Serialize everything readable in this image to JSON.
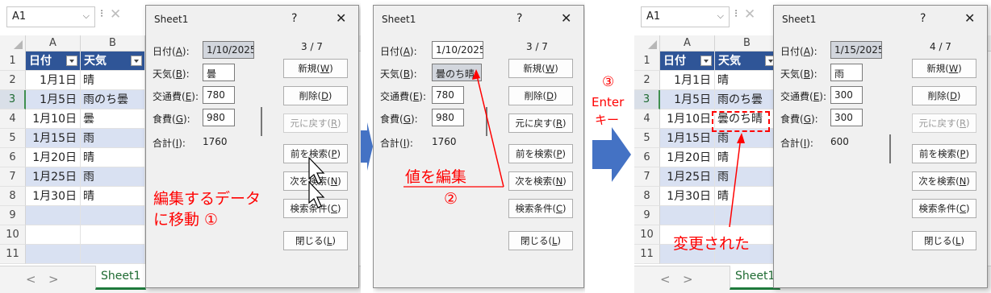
{
  "columns": [
    "A",
    "B"
  ],
  "row_numbers": [
    "1",
    "2",
    "3",
    "4",
    "5",
    "6",
    "7",
    "8",
    "9",
    "10",
    "11"
  ],
  "sheet_tab": "Sheet1",
  "tab_nav": {
    "prev": "<",
    "next": ">"
  },
  "dialog_title": "Sheet1",
  "dialog_help": "?",
  "dialog_close": "✕",
  "labels": {
    "date": {
      "pre": "日付(",
      "key": "A",
      "post": "):"
    },
    "weather": {
      "pre": "天気(",
      "key": "B",
      "post": "):"
    },
    "transport": {
      "pre": "交通費(",
      "key": "E",
      "post": "):"
    },
    "food": {
      "pre": "食費(",
      "key": "G",
      "post": "):"
    },
    "total": {
      "pre": "合計(",
      "key": "I",
      "post": "):"
    }
  },
  "buttons": {
    "new": {
      "pre": "新規(",
      "key": "W",
      "post": ")"
    },
    "delete": {
      "pre": "削除(",
      "key": "D",
      "post": ")"
    },
    "restore": {
      "pre": "元に戻す(",
      "key": "R",
      "post": ")"
    },
    "find_prev": {
      "pre": "前を検索(",
      "key": "P",
      "post": ")"
    },
    "find_next": {
      "pre": "次を検索(",
      "key": "N",
      "post": ")"
    },
    "criteria": {
      "pre": "検索条件(",
      "key": "C",
      "post": ")"
    },
    "close": {
      "pre": "閉じる(",
      "key": "L",
      "post": ")"
    }
  },
  "panel1": {
    "namebox": "A1",
    "header": [
      "日付",
      "天気"
    ],
    "rows": [
      [
        "1月1日",
        "晴"
      ],
      [
        "1月5日",
        "雨のち曇"
      ],
      [
        "1月10日",
        "曇"
      ],
      [
        "1月15日",
        "雨"
      ],
      [
        "1月20日",
        "晴"
      ],
      [
        "1月25日",
        "雨"
      ],
      [
        "1月30日",
        "晴"
      ]
    ],
    "selected_row": "3",
    "form": {
      "date": "1/10/2025",
      "weather": "曇",
      "transport": "780",
      "food": "980",
      "total": "1760",
      "counter": "3 / 7"
    },
    "annotation_line1": "編集するデータ",
    "annotation_line2": "に移動 ①"
  },
  "panel2": {
    "form": {
      "date": "1/10/2025",
      "weather": "曇のち晴",
      "transport": "780",
      "food": "980",
      "total": "1760",
      "counter": "3 / 7"
    },
    "annotation_edit": "値を編集",
    "annotation_num": "②"
  },
  "panel3": {
    "namebox": "A1",
    "header": [
      "日付",
      "天気"
    ],
    "rows": [
      [
        "1月1日",
        "晴"
      ],
      [
        "1月5日",
        "雨のち曇"
      ],
      [
        "1月10日",
        "曇のち晴"
      ],
      [
        "1月15日",
        "雨"
      ],
      [
        "1月20日",
        "晴"
      ],
      [
        "1月25日",
        "雨"
      ],
      [
        "1月30日",
        "晴"
      ]
    ],
    "selected_row": "3",
    "form": {
      "date": "1/15/2025",
      "weather": "雨",
      "transport": "300",
      "food": "300",
      "total": "600",
      "counter": "4 / 7"
    },
    "annotation_changed": "変更された"
  },
  "between": {
    "step": "③",
    "enter": "Enter",
    "key": "キー"
  },
  "colors": {
    "annotation": "#ff0000",
    "arrow": "#4472c4",
    "table_header": "#2f5597",
    "band": "#d9e1f2"
  }
}
